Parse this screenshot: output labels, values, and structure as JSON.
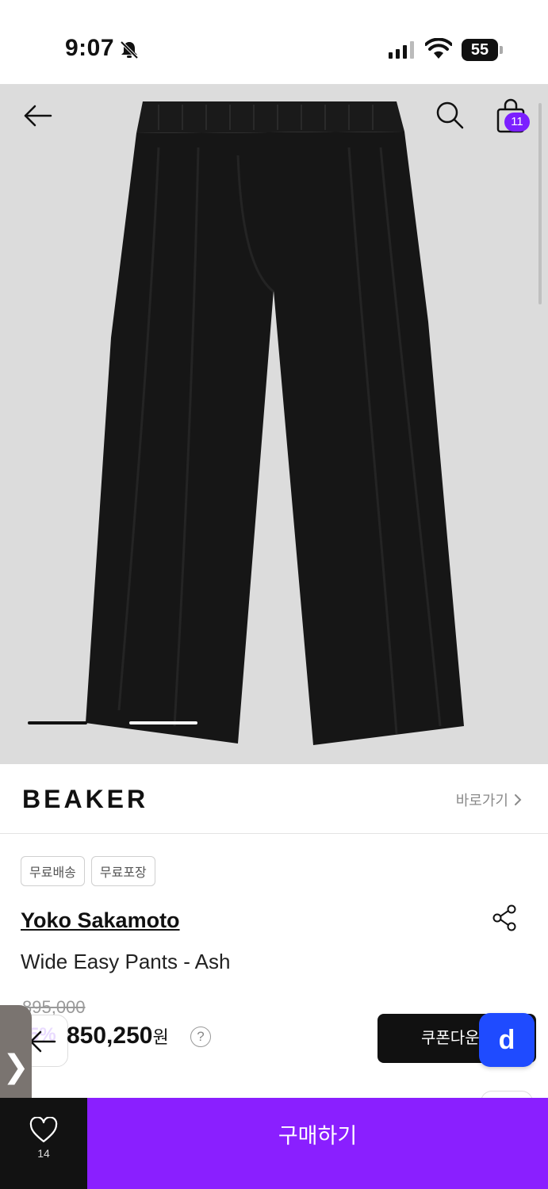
{
  "status_bar": {
    "time": "9:07",
    "battery": "55"
  },
  "hero": {
    "cart_count": "11",
    "icons": [
      "back-arrow-icon",
      "search-icon",
      "shopping-bag-icon"
    ],
    "pager": {
      "current": 1,
      "total": 2
    }
  },
  "brand": {
    "logo": "BEAKER",
    "link_label": "바로가기"
  },
  "product": {
    "tags": [
      "무료배송",
      "무료포장"
    ],
    "designer": "Yoko Sakamoto",
    "name": "Wide Easy Pants - Ash",
    "original_price": "895,000",
    "discount_rate": "5%",
    "sale_price": "850,250",
    "currency": "원",
    "help": "?"
  },
  "coupon": {
    "label": "쿠폰다운",
    "badge": "d"
  },
  "side_tab": {
    "label": "❯"
  },
  "bottom_bar": {
    "wish_count": "14",
    "buy_label": "구매하기"
  },
  "colors": {
    "accent_purple": "#8a1fff",
    "badge_blue": "#1f4bff",
    "hero_bg": "#dcdcdc"
  }
}
